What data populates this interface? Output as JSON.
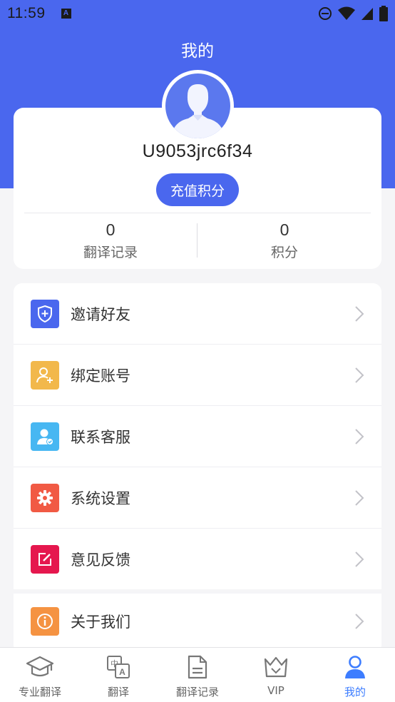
{
  "status_bar": {
    "time": "11:59"
  },
  "header": {
    "title": "我的"
  },
  "profile": {
    "username": "U9053jrc6f34",
    "recharge_label": "充值积分",
    "stats": [
      {
        "value": "0",
        "label": "翻译记录"
      },
      {
        "value": "0",
        "label": "积分"
      }
    ]
  },
  "menu": {
    "items": [
      {
        "label": "邀请好友",
        "icon": "shield-plus-icon",
        "color": "#4a67ee"
      },
      {
        "label": "绑定账号",
        "icon": "add-user-icon",
        "color": "#f2b84b"
      },
      {
        "label": "联系客服",
        "icon": "customer-service-icon",
        "color": "#47b7f2"
      },
      {
        "label": "系统设置",
        "icon": "gear-icon",
        "color": "#f15a44"
      },
      {
        "label": "意见反馈",
        "icon": "edit-icon",
        "color": "#e5174e"
      },
      {
        "label": "关于我们",
        "icon": "info-icon",
        "color": "#f59342"
      }
    ]
  },
  "tab_bar": {
    "tabs": [
      {
        "label": "专业翻译",
        "icon": "graduation-cap-icon"
      },
      {
        "label": "翻译",
        "icon": "translate-icon"
      },
      {
        "label": "翻译记录",
        "icon": "document-icon"
      },
      {
        "label": "VIP",
        "icon": "crown-icon"
      },
      {
        "label": "我的",
        "icon": "person-icon",
        "active": true
      }
    ],
    "active_color": "#3d7dff"
  },
  "colors": {
    "primary": "#4a67ee",
    "background": "#f5f5f7"
  }
}
